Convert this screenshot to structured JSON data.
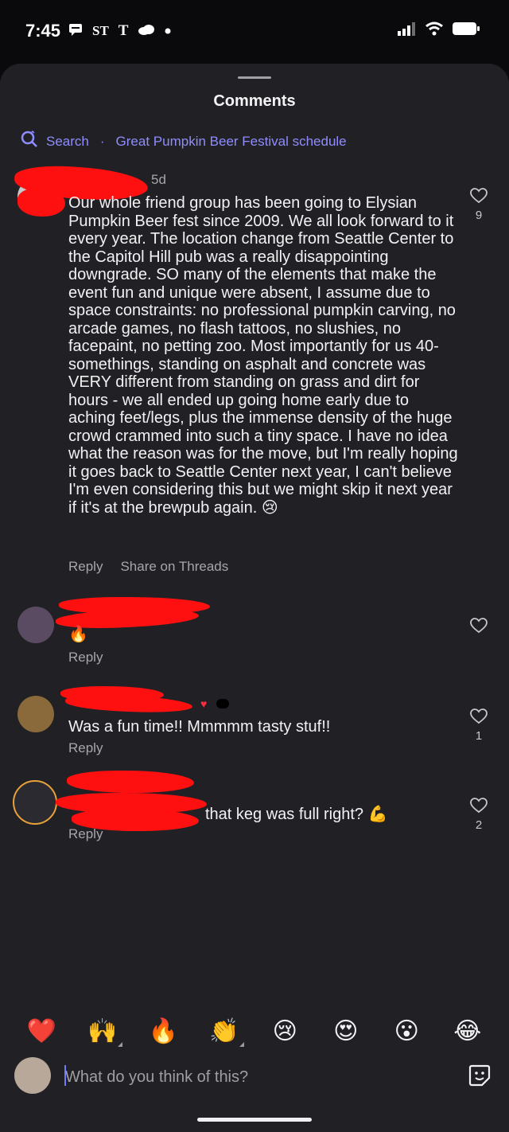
{
  "status_bar": {
    "time": "7:45",
    "left_icons": [
      "chat-bubble-icon",
      "news-icon",
      "nyt-icon",
      "cloud-icon",
      "dot-icon"
    ],
    "right_icons": [
      "signal-icon",
      "wifi-icon",
      "battery-icon"
    ]
  },
  "sheet": {
    "title": "Comments",
    "search": {
      "prefix": "Search",
      "separator": "·",
      "query": "Great Pumpkin Beer Festival schedule"
    }
  },
  "comments": [
    {
      "author": "",
      "age": "5d",
      "text": "Our whole friend group has been going to Elysian Pumpkin Beer fest since 2009. We all look forward to it every year. The location change from Seattle Center to the Capitol Hill pub was a really disappointing downgrade. SO many of the elements that make the event fun and unique were absent, I assume due to space constraints: no professional pumpkin carving, no arcade games, no flash tattoos, no slushies, no facepaint, no petting zoo. Most importantly for us 40-somethings, standing on asphalt and concrete was VERY different from standing on grass and dirt for hours - we all ended up going home early due to aching feet/legs, plus the immense density of the huge crowd crammed into such a tiny space. I have no idea what the reason was for the move, but I'm really hoping it goes back to Seattle Center next year, I can't believe I'm even considering this but we might skip it next year if it's at the brewpub again. 😢",
      "actions": [
        "Reply",
        "Share on Threads"
      ],
      "likes": "9"
    },
    {
      "author": "",
      "text": "🔥",
      "actions": [
        "Reply"
      ],
      "likes": ""
    },
    {
      "author": "",
      "text": "Was a fun time!! Mmmmm tasty stuf!!",
      "actions": [
        "Reply"
      ],
      "likes": "1"
    },
    {
      "author": "",
      "text": "that keg was full right? 💪",
      "actions": [
        "Reply"
      ],
      "likes": "2"
    }
  ],
  "reactions": [
    "❤️",
    "🙌",
    "🔥",
    "👏",
    "😢",
    "😍",
    "😮",
    "😂"
  ],
  "composer": {
    "placeholder": "What do you think of this?"
  },
  "colors": {
    "sheet_bg": "#212125",
    "accent": "#8f8cff",
    "redaction": "#ff1010"
  }
}
